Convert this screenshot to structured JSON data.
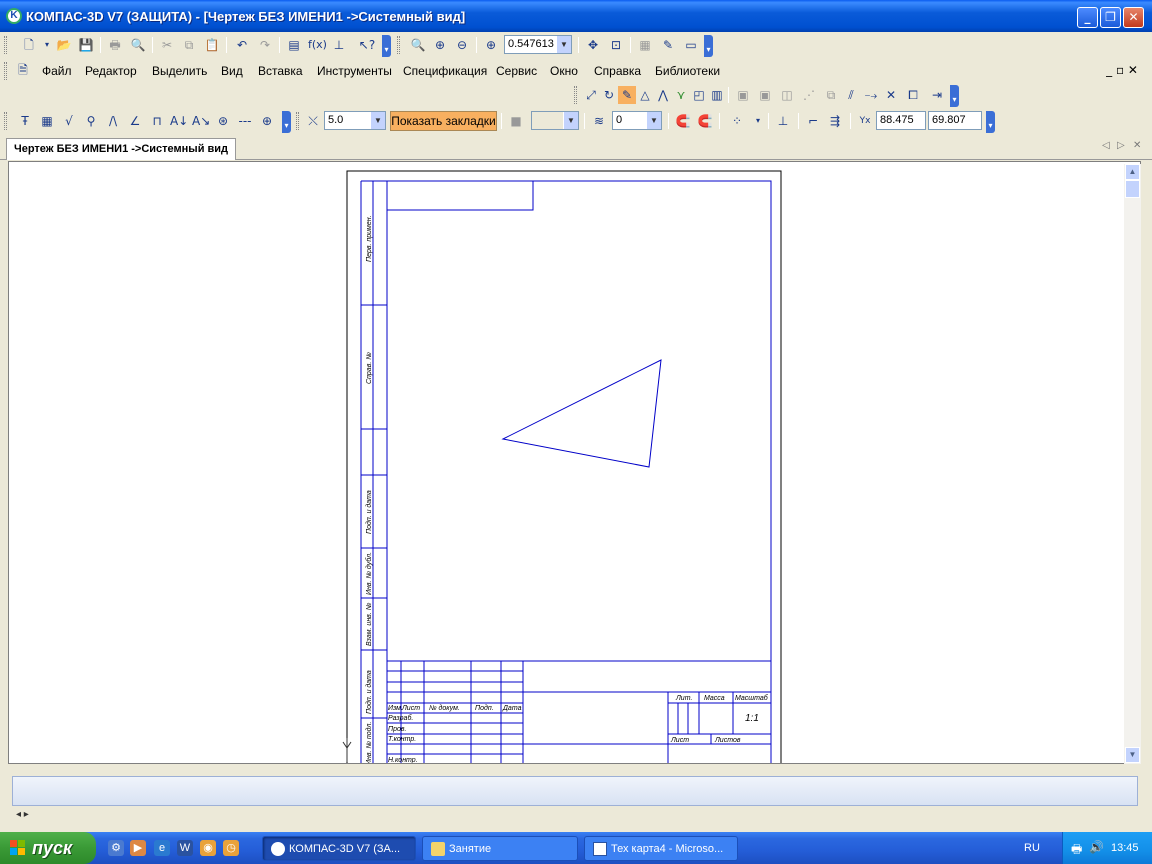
{
  "window": {
    "title": "КОМПАС-3D V7 (ЗАЩИТА) - [Чертеж БЕЗ ИМЕНИ1 ->Системный вид]",
    "app_icon_letter": "K"
  },
  "toolbar": {
    "zoom_value": "0.547613"
  },
  "menu": {
    "items": [
      "Файл",
      "Редактор",
      "Выделить",
      "Вид",
      "Вставка",
      "Инструменты",
      "Спецификация",
      "Сервис",
      "Окно",
      "Справка",
      "Библиотеки"
    ]
  },
  "props_bar": {
    "step_value": "5.0",
    "show_bookmarks_label": "Показать закладки",
    "layer_value": "0",
    "coord_x": "88.475",
    "coord_y": "69.807"
  },
  "document_tab": {
    "label": "Чертеж БЕЗ ИМЕНИ1 ->Системный вид"
  },
  "drawing": {
    "side_stamps": [
      "Перв. примен.",
      "Справ. №",
      "Подп. и дата",
      "Инв. № дубл.",
      "Взам. инв. №",
      "Подп. и дата",
      "Инв. № подл."
    ],
    "title_block": {
      "headers": [
        "Изм.",
        "Лист",
        "№ докум.",
        "Подп.",
        "Дата"
      ],
      "rows": [
        "Разраб.",
        "Пров.",
        "Т.контр.",
        "",
        "Н.контр."
      ],
      "lit_label": "Лит.",
      "mass_label": "Масса",
      "scale_label": "Масштаб",
      "scale_value": "1:1",
      "sheet_label": "Лист",
      "sheets_label": "Листов"
    },
    "triangle_color": "#0000c8",
    "frame_color": "#0000c8"
  },
  "taskbar": {
    "start_label": "пуск",
    "tasks": [
      {
        "label": "КОМПАС-3D V7 (ЗА..."
      },
      {
        "label": "Занятие"
      },
      {
        "label": "Тех карта4 - Microso..."
      }
    ],
    "lang": "RU",
    "clock": "13:45"
  }
}
